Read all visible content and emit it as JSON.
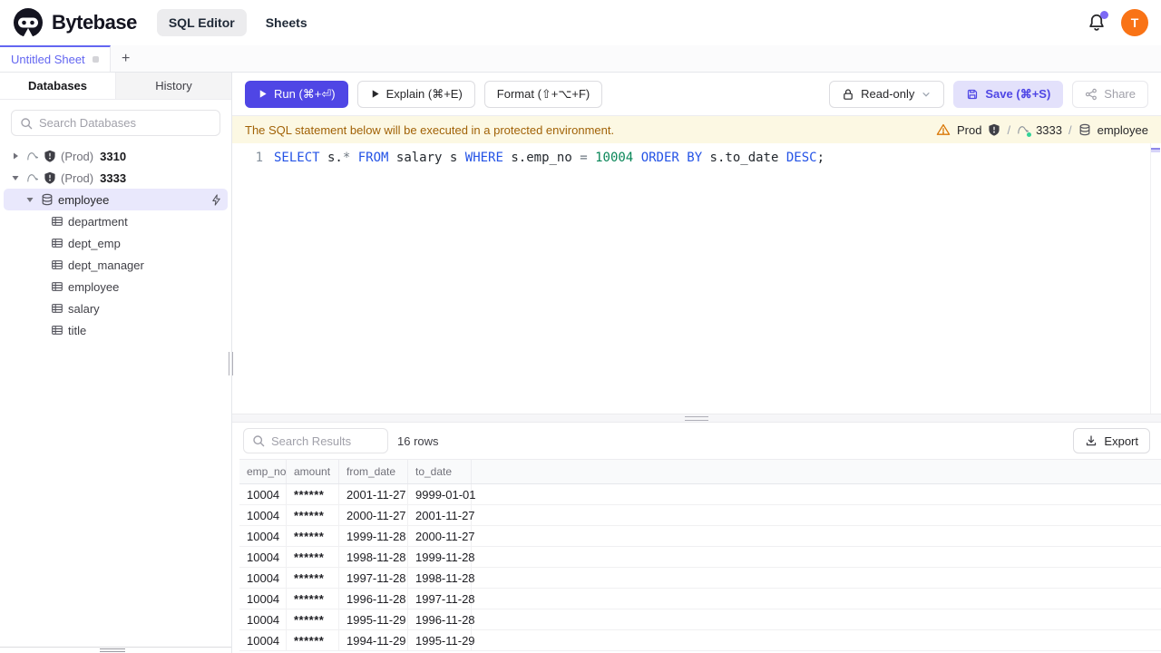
{
  "colors": {
    "accent": "#4f46e5",
    "accent-soft": "#e3e1fb",
    "tab-active": "#6366f1",
    "avatar-bg": "#f97316",
    "banner-bg": "#fcf8e3",
    "banner-text": "#a16207",
    "warning": "#d97706",
    "success": "#34d399",
    "sql-keyword": "#2453e6",
    "sql-number": "#098658",
    "sql-operator": "#6e7781",
    "sql-text": "#24292f",
    "selected-row-bg": "#e9e8fc"
  },
  "header": {
    "brand": "Bytebase",
    "nav": [
      {
        "label": "SQL Editor",
        "active": true
      },
      {
        "label": "Sheets",
        "active": false
      }
    ],
    "avatar_initial": "T"
  },
  "sheet_tabs": {
    "active_tab": "Untitled Sheet",
    "add_tab": "+"
  },
  "sidebar": {
    "tabs": [
      {
        "label": "Databases",
        "active": true
      },
      {
        "label": "History",
        "active": false
      }
    ],
    "search_placeholder": "Search Databases",
    "tree": {
      "instances": [
        {
          "env": "(Prod)",
          "name": "3310",
          "expanded": false
        },
        {
          "env": "(Prod)",
          "name": "3333",
          "expanded": true
        }
      ],
      "database": "employee",
      "tables": [
        "department",
        "dept_emp",
        "dept_manager",
        "employee",
        "salary",
        "title"
      ]
    }
  },
  "toolbar": {
    "run": "Run (⌘+⏎)",
    "explain": "Explain (⌘+E)",
    "format": "Format (⇧+⌥+F)",
    "readonly": "Read-only",
    "save": "Save (⌘+S)",
    "share": "Share"
  },
  "banner": {
    "message": "The SQL statement below will be executed in a protected environment.",
    "environment": "Prod",
    "separator": "/",
    "instance": "3333",
    "database": "employee"
  },
  "editor": {
    "line_number": "1",
    "sql": "SELECT s.* FROM salary s WHERE s.emp_no = 10004 ORDER BY s.to_date DESC;",
    "tokens": [
      {
        "t": "SELECT",
        "c": "kw"
      },
      {
        "t": " s.",
        "c": "id"
      },
      {
        "t": "*",
        "c": "op"
      },
      {
        "t": " ",
        "c": "id"
      },
      {
        "t": "FROM",
        "c": "kw"
      },
      {
        "t": " salary s ",
        "c": "id"
      },
      {
        "t": "WHERE",
        "c": "kw"
      },
      {
        "t": " s.emp_no ",
        "c": "id"
      },
      {
        "t": "=",
        "c": "op"
      },
      {
        "t": " ",
        "c": "id"
      },
      {
        "t": "10004",
        "c": "num"
      },
      {
        "t": " ",
        "c": "id"
      },
      {
        "t": "ORDER BY",
        "c": "kw"
      },
      {
        "t": " s.to_date ",
        "c": "id"
      },
      {
        "t": "DESC",
        "c": "kw"
      },
      {
        "t": ";",
        "c": "id"
      }
    ]
  },
  "results": {
    "search_placeholder": "Search Results",
    "row_count": "16 rows",
    "export": "Export",
    "table": {
      "columns": [
        "emp_no",
        "amount",
        "from_date",
        "to_date"
      ],
      "rows": [
        [
          "10004",
          "******",
          "2001-11-27",
          "9999-01-01"
        ],
        [
          "10004",
          "******",
          "2000-11-27",
          "2001-11-27"
        ],
        [
          "10004",
          "******",
          "1999-11-28",
          "2000-11-27"
        ],
        [
          "10004",
          "******",
          "1998-11-28",
          "1999-11-28"
        ],
        [
          "10004",
          "******",
          "1997-11-28",
          "1998-11-28"
        ],
        [
          "10004",
          "******",
          "1996-11-28",
          "1997-11-28"
        ],
        [
          "10004",
          "******",
          "1995-11-29",
          "1996-11-28"
        ],
        [
          "10004",
          "******",
          "1994-11-29",
          "1995-11-29"
        ]
      ]
    }
  }
}
